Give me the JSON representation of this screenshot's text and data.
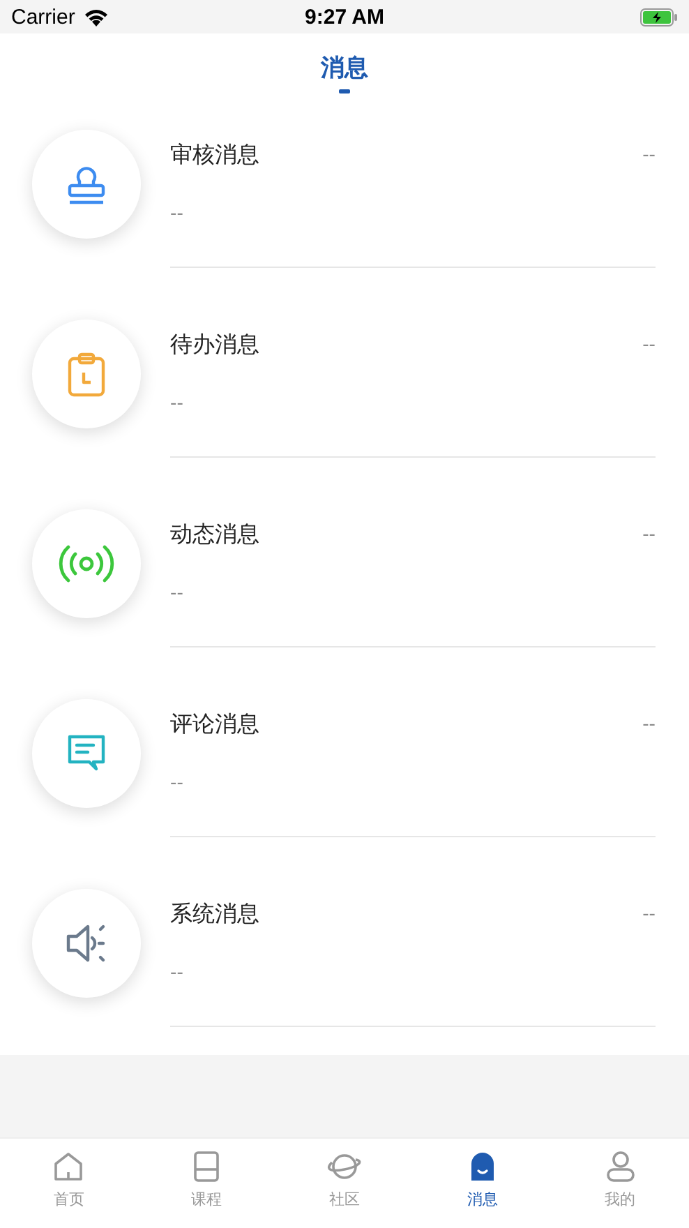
{
  "status_bar": {
    "carrier": "Carrier",
    "time": "9:27 AM"
  },
  "header": {
    "title": "消息"
  },
  "messages": [
    {
      "kind": "stamp",
      "title": "审核消息",
      "time": "--",
      "preview": "--"
    },
    {
      "kind": "clipboard",
      "title": "待办消息",
      "time": "--",
      "preview": "--"
    },
    {
      "kind": "broadcast",
      "title": "动态消息",
      "time": "--",
      "preview": "--"
    },
    {
      "kind": "comment",
      "title": "评论消息",
      "time": "--",
      "preview": "--"
    },
    {
      "kind": "speaker",
      "title": "系统消息",
      "time": "--",
      "preview": "--"
    }
  ],
  "tab_bar": [
    {
      "kind": "home",
      "label": "首页",
      "selected": false
    },
    {
      "kind": "course",
      "label": "课程",
      "selected": false
    },
    {
      "kind": "community",
      "label": "社区",
      "selected": false
    },
    {
      "kind": "message",
      "label": "消息",
      "selected": true
    },
    {
      "kind": "profile",
      "label": "我的",
      "selected": false
    }
  ]
}
